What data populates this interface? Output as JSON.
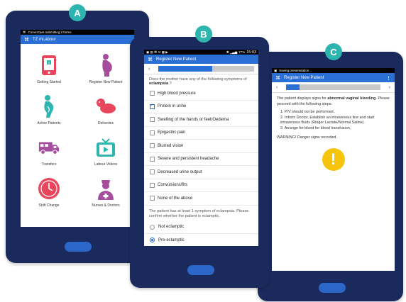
{
  "markers": {
    "a": "A",
    "b": "B",
    "c": "C"
  },
  "colors": {
    "tablet": "#1b2a5c",
    "accent": "#2a6fd6",
    "marker": "#2eb5b0",
    "warning": "#f6c40a",
    "home_button": "#2a67c9"
  },
  "screen_a": {
    "status_text": "CommCare submitting 2 forms",
    "app_title": "TZ mLabour",
    "tiles": [
      {
        "label": "Getting Started",
        "icon": "phone-info-icon"
      },
      {
        "label": "Register New Patient",
        "icon": "pregnant-woman-icon"
      },
      {
        "label": "Active Patients",
        "icon": "pregnant-profile-icon"
      },
      {
        "label": "Deliveries",
        "icon": "baby-icon"
      },
      {
        "label": "Transfers",
        "icon": "ambulance-icon"
      },
      {
        "label": "Labour Videos",
        "icon": "tv-play-icon"
      },
      {
        "label": "Shift Change",
        "icon": "clock-icon"
      },
      {
        "label": "Nurses & Doctors",
        "icon": "nurse-icon"
      }
    ]
  },
  "screen_b": {
    "status_time": "15:03",
    "status_battery": "77%",
    "title": "Register New Patient",
    "progress": 0.56,
    "question_start": "Does the mother have any of the following symptoms of",
    "question_bold": "eclampsia",
    "question_end": "?",
    "options": [
      {
        "label": "High blood pressure",
        "checked": false
      },
      {
        "label": "Protein in urine",
        "checked": true
      },
      {
        "label": "Swelling of the hands or feet/Oedema",
        "checked": false
      },
      {
        "label": "Epigastric pain",
        "checked": false
      },
      {
        "label": "Blurred vision",
        "checked": false
      },
      {
        "label": "Severe and persistent headache",
        "checked": false
      },
      {
        "label": "Decreased urine output",
        "checked": false
      },
      {
        "label": "Convulsions/fits",
        "checked": false
      },
      {
        "label": "None of the above",
        "checked": false
      }
    ],
    "followup": "The patient has at least 1 symptom of eclampsia. Please confirm whether the patient is eclamptic.",
    "radios": [
      {
        "label": "Not eclamptic",
        "selected": false
      },
      {
        "label": "Pre-eclamptic",
        "selected": true
      }
    ]
  },
  "screen_c": {
    "status_text": "Saving presenstation...",
    "title": "Register New Patient",
    "progress": 0.14,
    "intro_start": "The patient displays signs for",
    "intro_bold": "abnormal vaginal bleeding",
    "intro_end": ". Please proceed with the following steps:",
    "steps": [
      "1.  P/V should not be performed .",
      "2.  Inform Doctor, Establish an intravenous line and start intravenous fluids (Ringer Lactate/Normal Saline).",
      "3.  Arrange for blood for blood transfusion."
    ],
    "warning_text": "WARNING! Danger signs recorded.",
    "warning_symbol": "!"
  }
}
